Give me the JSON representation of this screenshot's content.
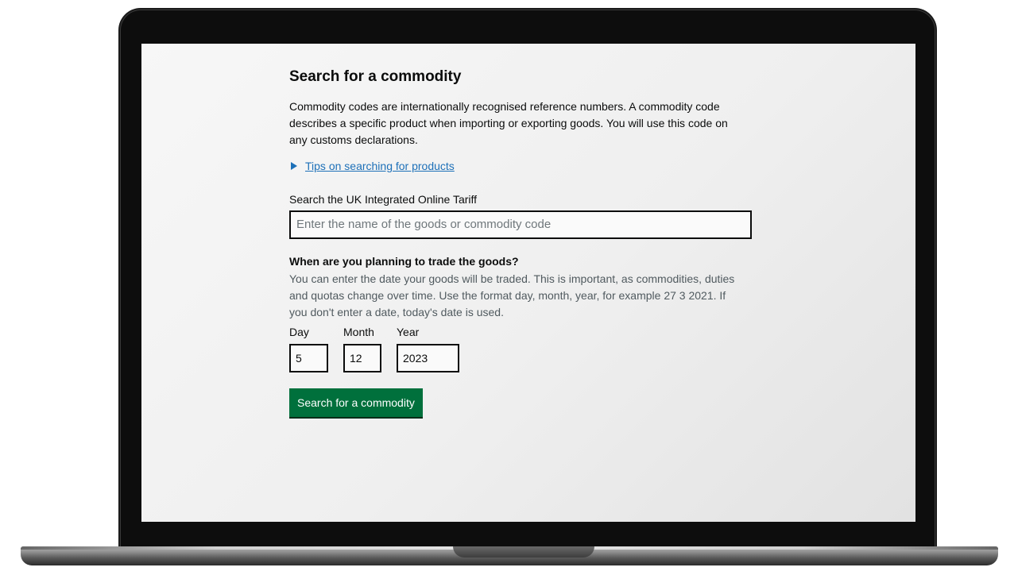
{
  "page": {
    "title": "Search for a commodity",
    "intro": "Commodity codes are internationally recognised reference numbers. A commodity code describes a specific product when importing or exporting goods. You will use this code on any customs declarations.",
    "details_summary": "Tips on searching for products"
  },
  "search": {
    "label": "Search the UK Integrated Online Tariff",
    "placeholder": "Enter the name of the goods or commodity code",
    "value": ""
  },
  "trade_date": {
    "legend": "When are you planning to trade the goods?",
    "hint": "You can enter the date your goods will be traded. This is important, as commodities, duties and quotas change over time. Use the format day, month, year, for example 27 3 2021. If you don't enter a date, today's date is used.",
    "day_label": "Day",
    "day_value": "5",
    "month_label": "Month",
    "month_value": "12",
    "year_label": "Year",
    "year_value": "2023"
  },
  "submit_label": "Search for a commodity",
  "colors": {
    "link": "#1d70b8",
    "button": "#00703c",
    "text": "#0b0c0c",
    "hint": "#505a5f"
  },
  "icons": {
    "details_toggle": "triangle-right-icon"
  }
}
